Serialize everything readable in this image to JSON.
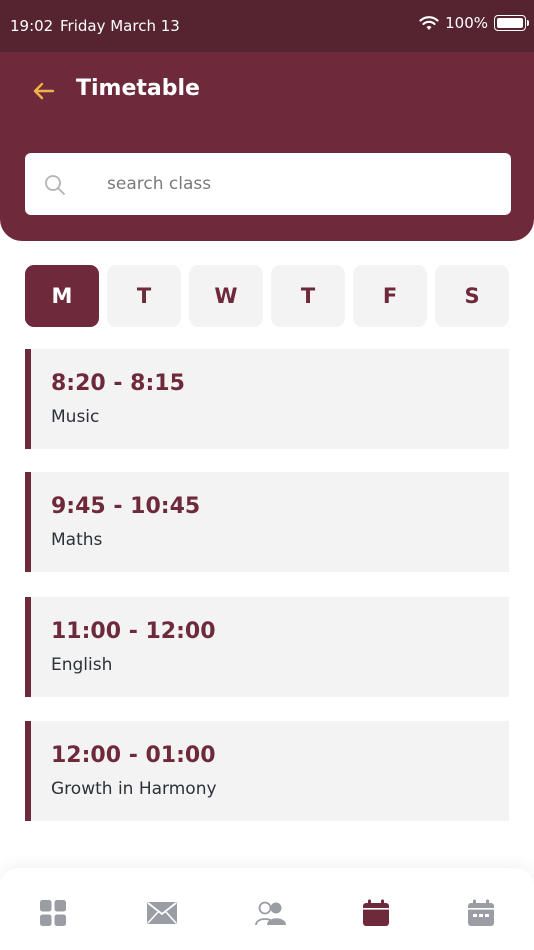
{
  "status_bar": {
    "time": "19:02",
    "date": "Friday March 13",
    "battery": "100%"
  },
  "header": {
    "title": "Timetable",
    "back_icon": "arrow-left-icon"
  },
  "search": {
    "placeholder": "search class",
    "value": ""
  },
  "days": [
    {
      "label": "M",
      "active": true
    },
    {
      "label": "T",
      "active": false
    },
    {
      "label": "W",
      "active": false
    },
    {
      "label": "T",
      "active": false
    },
    {
      "label": "F",
      "active": false
    },
    {
      "label": "S",
      "active": false
    }
  ],
  "classes": [
    {
      "time": "8:20 - 8:15",
      "subject": "Music"
    },
    {
      "time": "9:45 - 10:45",
      "subject": "Maths"
    },
    {
      "time": "11:00 - 12:00",
      "subject": "English"
    },
    {
      "time": "12:00 - 01:00",
      "subject": "Growth in Harmony"
    }
  ],
  "bottom_nav": [
    {
      "icon": "grid-icon",
      "active": false
    },
    {
      "icon": "mail-icon",
      "active": false
    },
    {
      "icon": "users-icon",
      "active": false
    },
    {
      "icon": "calendar-icon",
      "active": true
    },
    {
      "icon": "schedule-icon",
      "active": false
    }
  ],
  "colors": {
    "primary": "#6e2a3b",
    "status_bar": "#562431",
    "accent_arrow": "#f0b24a",
    "card_bg": "#f4f3f4",
    "nav_inactive": "#9a9da3"
  }
}
